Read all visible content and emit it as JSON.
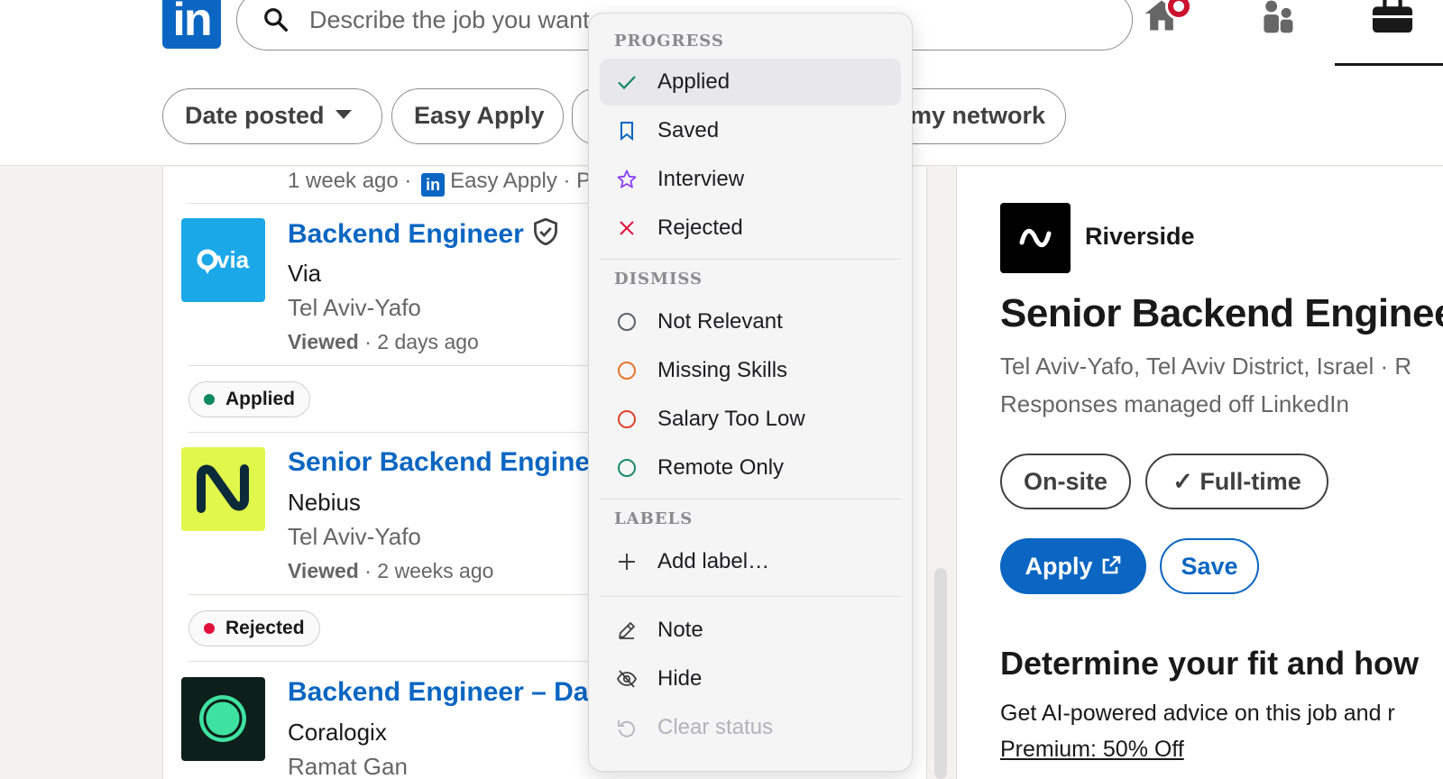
{
  "header": {
    "logo_text": "in",
    "search_placeholder": "Describe the job you want",
    "filters": {
      "date_posted": "Date posted",
      "easy_apply": "Easy Apply",
      "network": "my network"
    }
  },
  "list": {
    "top_meta": {
      "age": "1 week ago · ",
      "easy_apply": "Easy Apply · P"
    },
    "jobs": [
      {
        "title": "Backend Engineer",
        "company": "Via",
        "location": "Tel Aviv-Yafo",
        "viewed_label": "Viewed",
        "viewed_time": " · 2 days ago",
        "logo_text": "via"
      },
      {
        "title": "Senior Backend Engine",
        "company": "Nebius",
        "location": "Tel Aviv-Yafo",
        "viewed_label": "Viewed",
        "viewed_time": " · 2 weeks ago",
        "logo_text": "N"
      },
      {
        "title": "Backend Engineer – Da",
        "company": "Coralogix",
        "location": "Ramat Gan"
      }
    ],
    "status_chips": [
      {
        "label": "Applied",
        "color": "#0e8a5f"
      },
      {
        "label": "Rejected",
        "color": "#e0103a"
      }
    ]
  },
  "detail": {
    "company": "Riverside",
    "title": "Senior Backend Enginee",
    "location": "Tel Aviv-Yafo, Tel Aviv District, Israel · R",
    "responses": "Responses managed off LinkedIn",
    "chip_onsite": "On-site",
    "chip_fulltime": "Full-time",
    "apply": "Apply",
    "save": "Save",
    "fit_heading": "Determine your fit and how",
    "ai_text": "Get AI-powered advice on this job and r",
    "premium_link": "Premium: 50% Off"
  },
  "menu": {
    "progress_label": "PROGRESS",
    "progress": [
      {
        "label": "Applied",
        "icon": "check-icon",
        "color": "#0e8a5f"
      },
      {
        "label": "Saved",
        "icon": "bookmark-icon",
        "color": "#0a66c2"
      },
      {
        "label": "Interview",
        "icon": "star-icon",
        "color": "#8a3ffc"
      },
      {
        "label": "Rejected",
        "icon": "x-icon",
        "color": "#e0103a"
      }
    ],
    "dismiss_label": "DISMISS",
    "dismiss": [
      {
        "label": "Not Relevant",
        "icon": "circle-icon",
        "color": "#5a6070"
      },
      {
        "label": "Missing Skills",
        "icon": "circle-icon",
        "color": "#e8762c"
      },
      {
        "label": "Salary Too Low",
        "icon": "circle-icon",
        "color": "#e0442e"
      },
      {
        "label": "Remote Only",
        "icon": "circle-icon",
        "color": "#1a8a6a"
      }
    ],
    "labels_label": "LABELS",
    "add_label": "Add label…",
    "note": "Note",
    "hide": "Hide",
    "clear_status": "Clear status"
  }
}
